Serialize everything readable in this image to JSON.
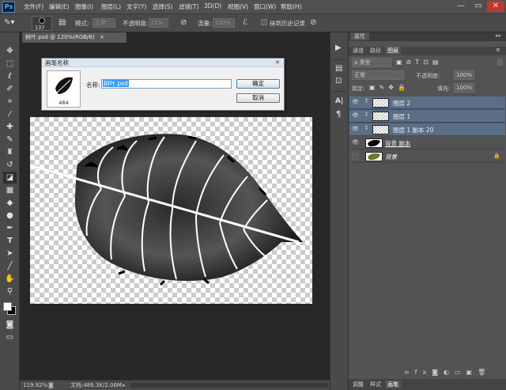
{
  "app": {
    "logo": "Ps"
  },
  "menu": [
    "文件(F)",
    "编辑(E)",
    "图像(I)",
    "图层(L)",
    "文字(Y)",
    "选择(S)",
    "滤镜(T)",
    "3D(D)",
    "视图(V)",
    "窗口(W)",
    "帮助(H)"
  ],
  "window_controls": {
    "minimize": "—",
    "maximize": "▭",
    "close": "✕"
  },
  "options_bar": {
    "brush_size": "137",
    "mode_label": "模式:",
    "mode_value": "正常",
    "opacity_label": "不透明度:",
    "opacity_value": "21%",
    "flow_label": "流量:",
    "flow_value": "100%",
    "history_label": "抹到历史记录"
  },
  "document": {
    "tab_title": "树叶.psd @ 120%(RGB/8)"
  },
  "dialog": {
    "title": "画笔名称",
    "brush_size": "484",
    "name_label": "名称:",
    "name_value": "树叶.psd",
    "ok_label": "确定",
    "cancel_label": "取消"
  },
  "panel": {
    "top_tab": "属性",
    "tabs": [
      "通道",
      "路径",
      "图层"
    ],
    "filter_label": "ρ 类型",
    "blend_mode": "正常",
    "opacity_label": "不透明度:",
    "opacity_value": "100%",
    "lock_label": "锁定:",
    "fill_label": "填充:",
    "fill_value": "100%",
    "bottom_tabs": [
      "调整",
      "样式",
      "画笔"
    ]
  },
  "layers": [
    {
      "name": "图层 2",
      "visible": true,
      "thumb": "transparent",
      "selected": true
    },
    {
      "name": "图层 1",
      "visible": true,
      "thumb": "transparent",
      "selected": true
    },
    {
      "name": "图层 1 副本 20",
      "visible": true,
      "thumb": "transparent",
      "selected": true
    },
    {
      "name": "背景 副本",
      "visible": true,
      "thumb": "leaf-black",
      "selected": false
    },
    {
      "name": "背景",
      "visible": false,
      "thumb": "leaf-green",
      "selected": false,
      "locked": true
    }
  ],
  "status": {
    "zoom": "119.92%",
    "doc_info": "文档:486.3K/2.06M"
  },
  "colors": {
    "accent": "#3399ff",
    "selected_layer": "#5a6e85",
    "ui_bg": "#535353"
  }
}
